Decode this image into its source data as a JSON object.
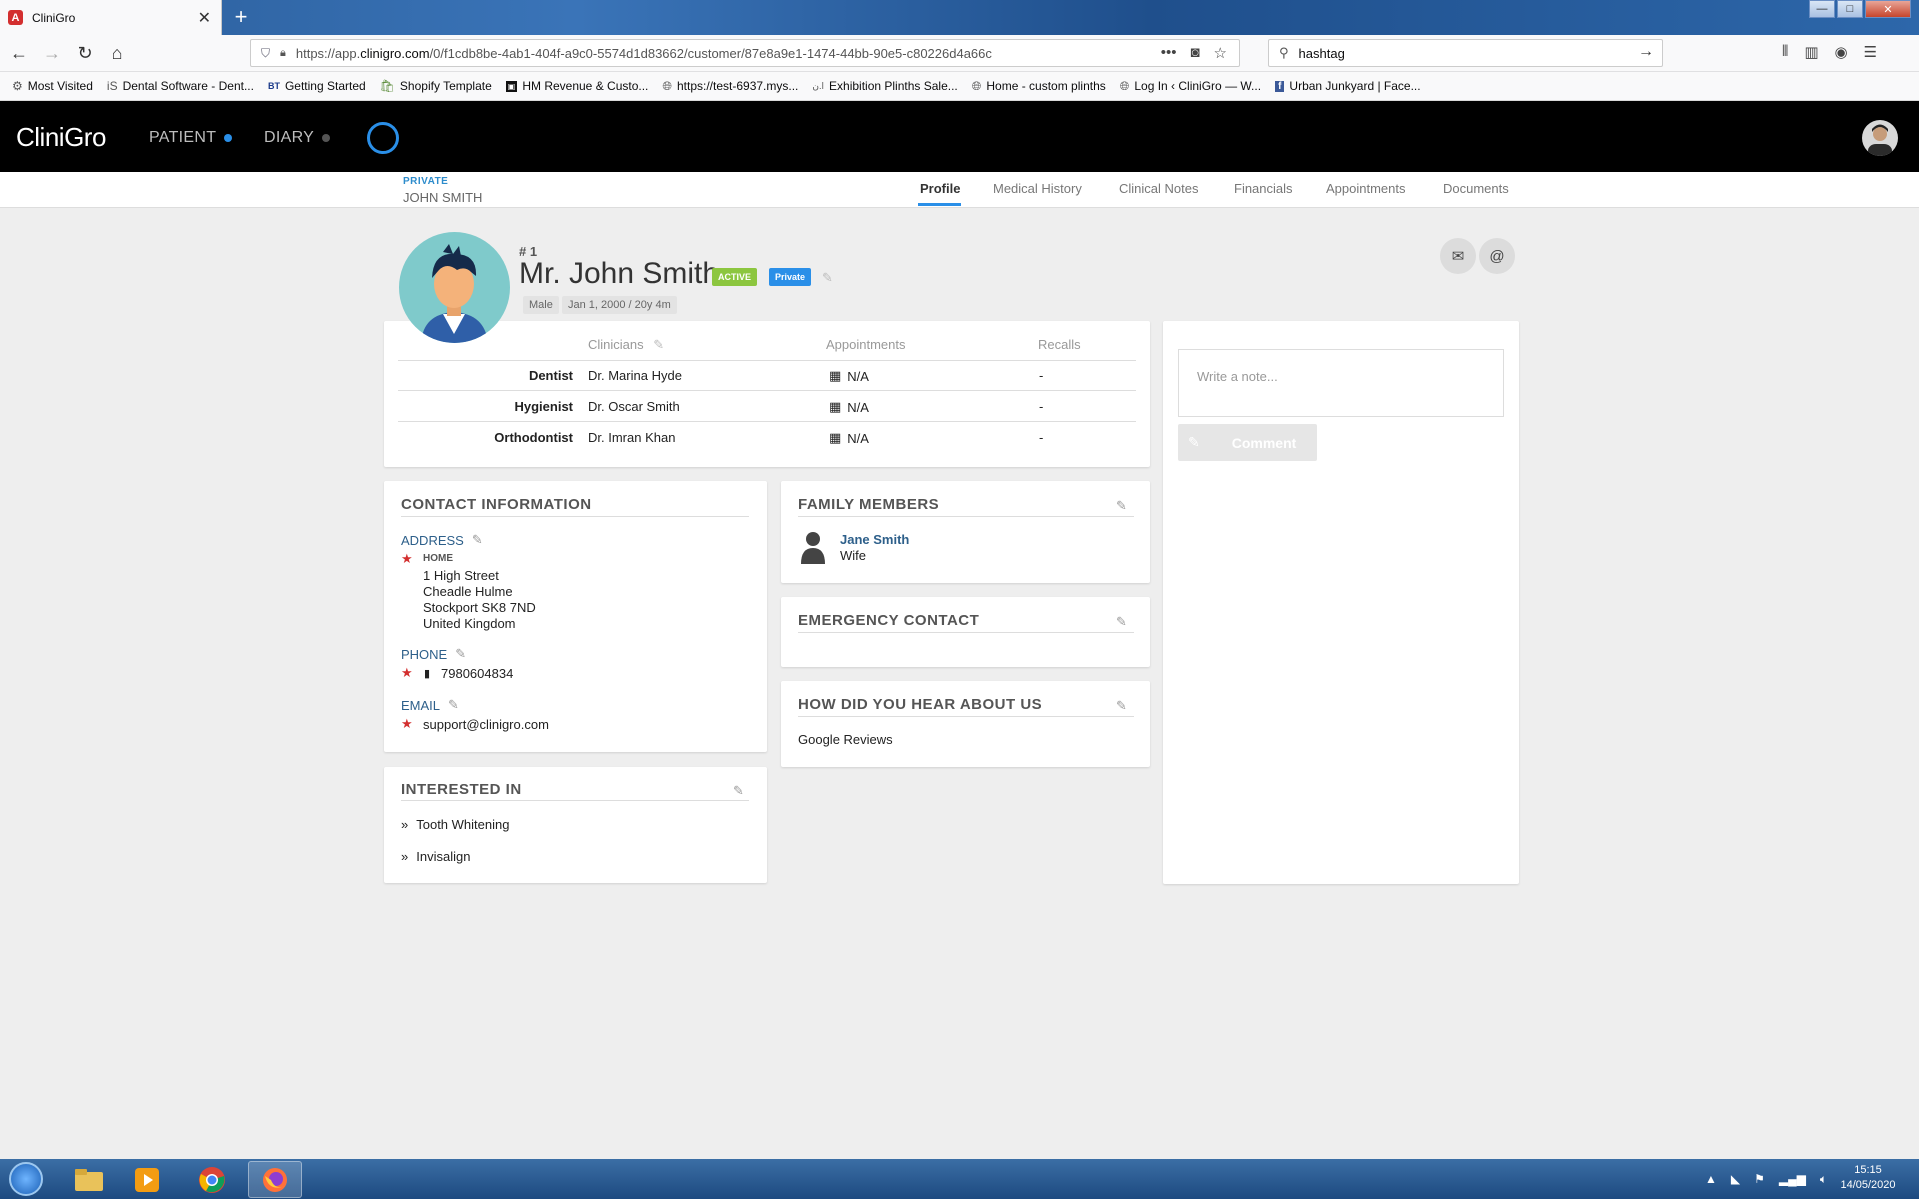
{
  "browser": {
    "tab_title": "CliniGro",
    "tab_favicon": "A",
    "url_prefix": "https://app.",
    "url_domain": "clinigro.com",
    "url_path": "/0/f1cdb8be-4ab1-404f-a9c0-5574d1d83662/customer/87e8a9e1-1474-44bb-90e5-c80226d4a66c",
    "search_value": "hashtag",
    "bookmarks": [
      {
        "label": "Most Visited",
        "icon": "gear-icon"
      },
      {
        "label": "Dental Software - Dent...",
        "icon": "iS"
      },
      {
        "label": "Getting Started",
        "icon": "BT"
      },
      {
        "label": "Shopify Template",
        "icon": "shopify-icon"
      },
      {
        "label": "HM Revenue & Custo...",
        "icon": "hmrc-icon"
      },
      {
        "label": "https://test-6937.mys...",
        "icon": "globe-icon"
      },
      {
        "label": "Exhibition Plinths Sale...",
        "icon": "plinth-icon"
      },
      {
        "label": "Home - custom plinths",
        "icon": "globe-icon"
      },
      {
        "label": "Log In ‹ CliniGro — W...",
        "icon": "globe-icon"
      },
      {
        "label": "Urban Junkyard | Face...",
        "icon": "facebook-icon"
      }
    ]
  },
  "app": {
    "logo": "CliniGro",
    "nav_patient": "PATIENT",
    "nav_diary": "DIARY",
    "accent": "#2a8fe8"
  },
  "subheader": {
    "patient_type": "PRIVATE",
    "patient_name": "JOHN SMITH",
    "tabs": [
      "Profile",
      "Medical History",
      "Clinical Notes",
      "Financials",
      "Appointments",
      "Documents"
    ]
  },
  "profile": {
    "number": "# 1",
    "full_name": "Mr. John Smith",
    "status_badge": "ACTIVE",
    "type_badge": "Private",
    "gender": "Male",
    "dob": "Jan 1, 2000 / 20y 4m"
  },
  "clinicians": {
    "headers": {
      "clinicians": "Clinicians",
      "appointments": "Appointments",
      "recalls": "Recalls"
    },
    "rows": [
      {
        "role": "Dentist",
        "name": "Dr. Marina Hyde",
        "appointment": "N/A",
        "recall": "-"
      },
      {
        "role": "Hygienist",
        "name": "Dr. Oscar Smith",
        "appointment": "N/A",
        "recall": "-"
      },
      {
        "role": "Orthodontist",
        "name": "Dr. Imran Khan",
        "appointment": "N/A",
        "recall": "-"
      }
    ]
  },
  "contact": {
    "title": "CONTACT INFORMATION",
    "address_label": "ADDRESS",
    "address_type": "HOME",
    "address_lines": [
      "1 High Street",
      "Cheadle Hulme",
      "Stockport SK8 7ND",
      "United Kingdom"
    ],
    "phone_label": "PHONE",
    "phone": "7980604834",
    "email_label": "EMAIL",
    "email": "support@clinigro.com"
  },
  "interested": {
    "title": "INTERESTED IN",
    "items": [
      "Tooth Whitening",
      "Invisalign"
    ]
  },
  "family": {
    "title": "FAMILY MEMBERS",
    "member_name": "Jane Smith",
    "member_relation": "Wife"
  },
  "emergency": {
    "title": "EMERGENCY CONTACT"
  },
  "hear": {
    "title": "HOW DID YOU HEAR ABOUT US",
    "value": "Google Reviews"
  },
  "notes": {
    "placeholder": "Write a note...",
    "button": "Comment"
  },
  "taskbar": {
    "time": "15:15",
    "date": "14/05/2020"
  }
}
